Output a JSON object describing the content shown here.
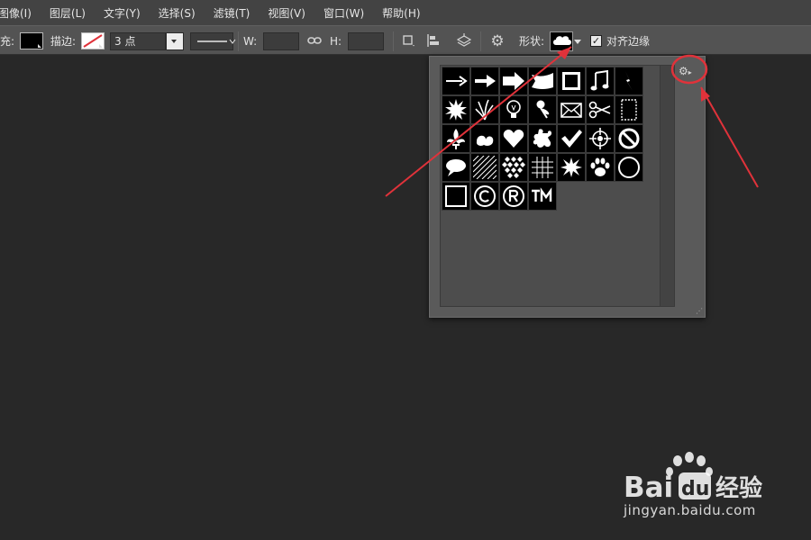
{
  "menubar": {
    "items": [
      "图像(I)",
      "图层(L)",
      "文字(Y)",
      "选择(S)",
      "滤镜(T)",
      "视图(V)",
      "窗口(W)",
      "帮助(H)"
    ]
  },
  "options": {
    "fill_label": "充:",
    "stroke_label": "描边:",
    "stroke_width": "3 点",
    "w_label": "W:",
    "h_label": "H:",
    "shape_label": "形状:",
    "align_edges_label": "对齐边缘",
    "align_edges_checked": true
  },
  "shape_picker": {
    "shapes": [
      "arrow-thin-icon",
      "arrow-bold-icon",
      "arrow-block-icon",
      "banner-icon",
      "frame-square-icon",
      "music-note-icon",
      "lightning-icon",
      "starburst-icon",
      "grass-icon",
      "lightbulb-icon",
      "pushpin-icon",
      "envelope-icon",
      "scissors-icon",
      "stamp-frame-icon",
      "fleur-de-lis-icon",
      "ornament-icon",
      "heart-icon",
      "puzzle-icon",
      "checkmark-icon",
      "crosshair-icon",
      "no-sign-icon",
      "speech-bubble-icon",
      "hatch-pattern-icon",
      "checkerboard-icon",
      "grid-pattern-icon",
      "burst-icon",
      "paw-print-icon",
      "circle-outline-icon",
      "square-outline-icon",
      "copyright-icon",
      "registered-icon",
      "trademark-icon"
    ]
  },
  "colors": {
    "menubar_bg": "#434343",
    "optionsbar_bg": "#535353",
    "canvas_bg": "#282828",
    "annotation_red": "#e0323a"
  },
  "watermark": {
    "logo_text": "Bai du 经验",
    "url": "jingyan.baidu.com"
  }
}
